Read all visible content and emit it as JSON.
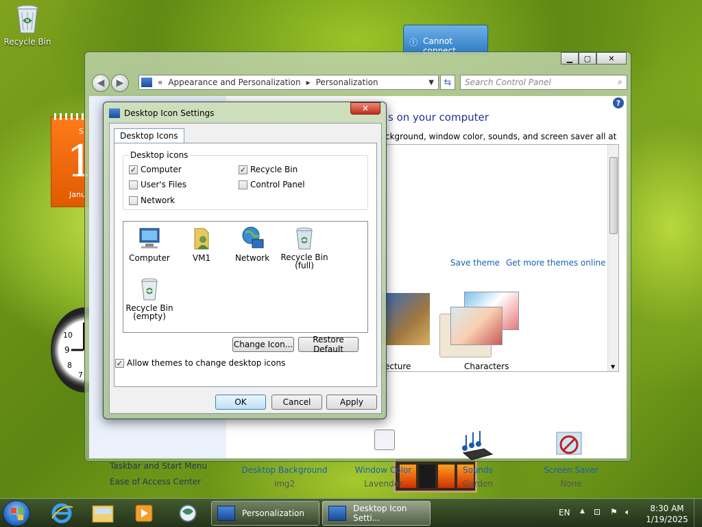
{
  "desktop": {
    "recycle_bin_label": "Recycle Bin",
    "calendar_month": "Janu",
    "calendar_weekday": "S",
    "calendar_day": "1",
    "notification_text": "Cannot connect"
  },
  "control_panel": {
    "breadcrumb_chevron": "«",
    "breadcrumb": [
      "Appearance and Personalization",
      "Personalization"
    ],
    "search_placeholder": "Search Control Panel",
    "heading": "s on your computer",
    "subheading": "ckground, window color, sounds, and screen saver all at once.",
    "theme_links": [
      "Save theme",
      "Get more themes online"
    ],
    "themes": [
      "itecture",
      "Characters"
    ],
    "sidebar_links": [
      "Taskbar and Start Menu",
      "Ease of Access Center"
    ],
    "bottom_items": [
      {
        "label": "Desktop Background",
        "value": "img2",
        "icon": "wallpaper-icon"
      },
      {
        "label": "Window Color",
        "value": "Lavender",
        "icon": "color-palette-icon"
      },
      {
        "label": "Sounds",
        "value": "Garden",
        "icon": "music-notes-icon"
      },
      {
        "label": "Screen Saver",
        "value": "None",
        "icon": "no-symbol-icon"
      }
    ]
  },
  "dialog": {
    "title": "Desktop Icon Settings",
    "tab": "Desktop Icons",
    "group_title": "Desktop icons",
    "checkboxes": [
      {
        "label": "Computer",
        "checked": true
      },
      {
        "label": "Recycle Bin",
        "checked": true
      },
      {
        "label": "User's Files",
        "checked": false
      },
      {
        "label": "Control Panel",
        "checked": false
      },
      {
        "label": "Network",
        "checked": false
      }
    ],
    "icons": [
      {
        "label": "Computer",
        "icon": "computer-icon"
      },
      {
        "label": "VM1",
        "icon": "user-folder-icon"
      },
      {
        "label": "Network",
        "icon": "network-globe-icon"
      },
      {
        "label": "Recycle Bin\n(full)",
        "icon": "recycle-bin-full-icon"
      },
      {
        "label": "Recycle Bin\n(empty)",
        "icon": "recycle-bin-empty-icon"
      }
    ],
    "change_icon_button": "Change Icon...",
    "restore_default_button": "Restore Default",
    "allow_themes_label": "Allow themes to change desktop icons",
    "allow_themes_checked": true,
    "ok_button": "OK",
    "cancel_button": "Cancel",
    "apply_button": "Apply"
  },
  "taskbar": {
    "tasks": [
      {
        "label": "Personalization",
        "icon": "control-panel-icon"
      },
      {
        "label": "Desktop Icon Setti...",
        "icon": "control-panel-icon"
      }
    ],
    "language": "EN",
    "time": "8:30 AM",
    "date": "1/19/2025"
  }
}
